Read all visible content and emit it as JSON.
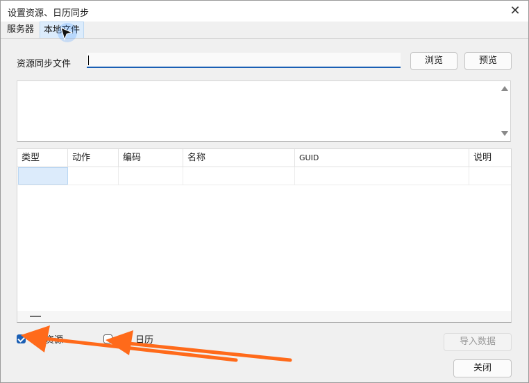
{
  "window": {
    "title": "设置资源、日历同步",
    "close_glyph": "✕"
  },
  "tabs": [
    {
      "label": "服务器"
    },
    {
      "label": "本地文件"
    }
  ],
  "sync_file": {
    "label": "资源同步文件",
    "value": "",
    "placeholder": ""
  },
  "buttons": {
    "browse": "浏览",
    "preview": "预览",
    "import": "导入数据",
    "close": "关闭"
  },
  "table": {
    "columns": [
      "类型",
      "动作",
      "编码",
      "名称",
      "GUID",
      "说明"
    ]
  },
  "options": {
    "resources": {
      "label": "资源",
      "checked": true
    },
    "calendar": {
      "label": "日历",
      "checked": false
    }
  },
  "annotation": {
    "color": "#ff6a1a"
  }
}
